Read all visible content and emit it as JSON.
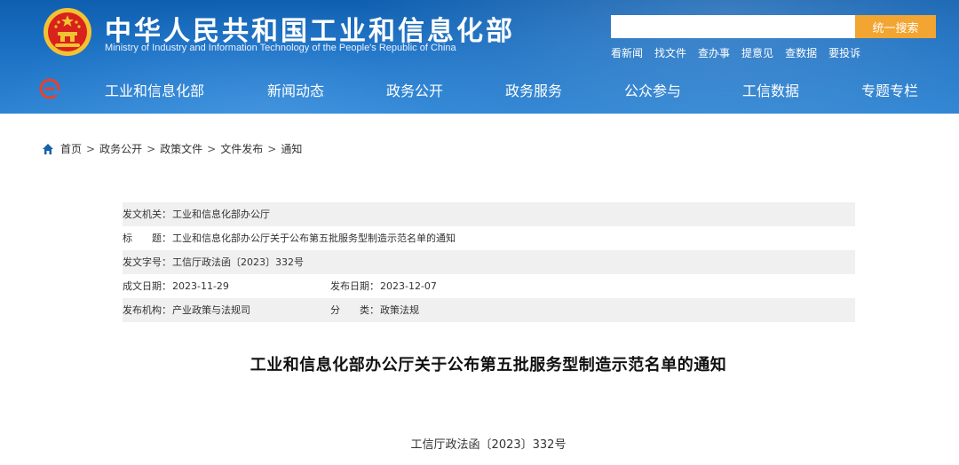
{
  "header": {
    "title": "中华人民共和国工业和信息化部",
    "subtitle": "Ministry of Industry and Information Technology of the People's Republic of China",
    "search": {
      "placeholder": "",
      "button_label": "统一搜索"
    },
    "quick_links": [
      "看新闻",
      "找文件",
      "查办事",
      "提意见",
      "查数据",
      "要投诉"
    ]
  },
  "nav": {
    "items": [
      "工业和信息化部",
      "新闻动态",
      "政务公开",
      "政务服务",
      "公众参与",
      "工信数据",
      "专题专栏"
    ]
  },
  "breadcrumb": [
    "首页",
    "政务公开",
    "政策文件",
    "文件发布",
    "通知"
  ],
  "breadcrumb_sep": ">",
  "meta": {
    "issuer_label": "发文机关：",
    "issuer": "工业和信息化部办公厅",
    "title_label": "标　　题：",
    "title": "工业和信息化部办公厅关于公布第五批服务型制造示范名单的通知",
    "doc_no_label": "发文字号：",
    "doc_no": "工信厅政法函〔2023〕332号",
    "created_label": "成文日期：",
    "created": "2023-11-29",
    "published_label": "发布日期：",
    "published": "2023-12-07",
    "org_label": "发布机构：",
    "org": "产业政策与法规司",
    "category_label": "分　　类：",
    "category": "政策法规"
  },
  "document": {
    "title": "工业和信息化部办公厅关于公布第五批服务型制造示范名单的通知",
    "number": "工信厅政法函〔2023〕332号"
  },
  "colors": {
    "header_blue": "#1a6fc2",
    "search_button": "#f2a531",
    "emblem_red": "#d8221c",
    "emblem_gold": "#f3c233",
    "home_icon": "#1a5fa8"
  }
}
